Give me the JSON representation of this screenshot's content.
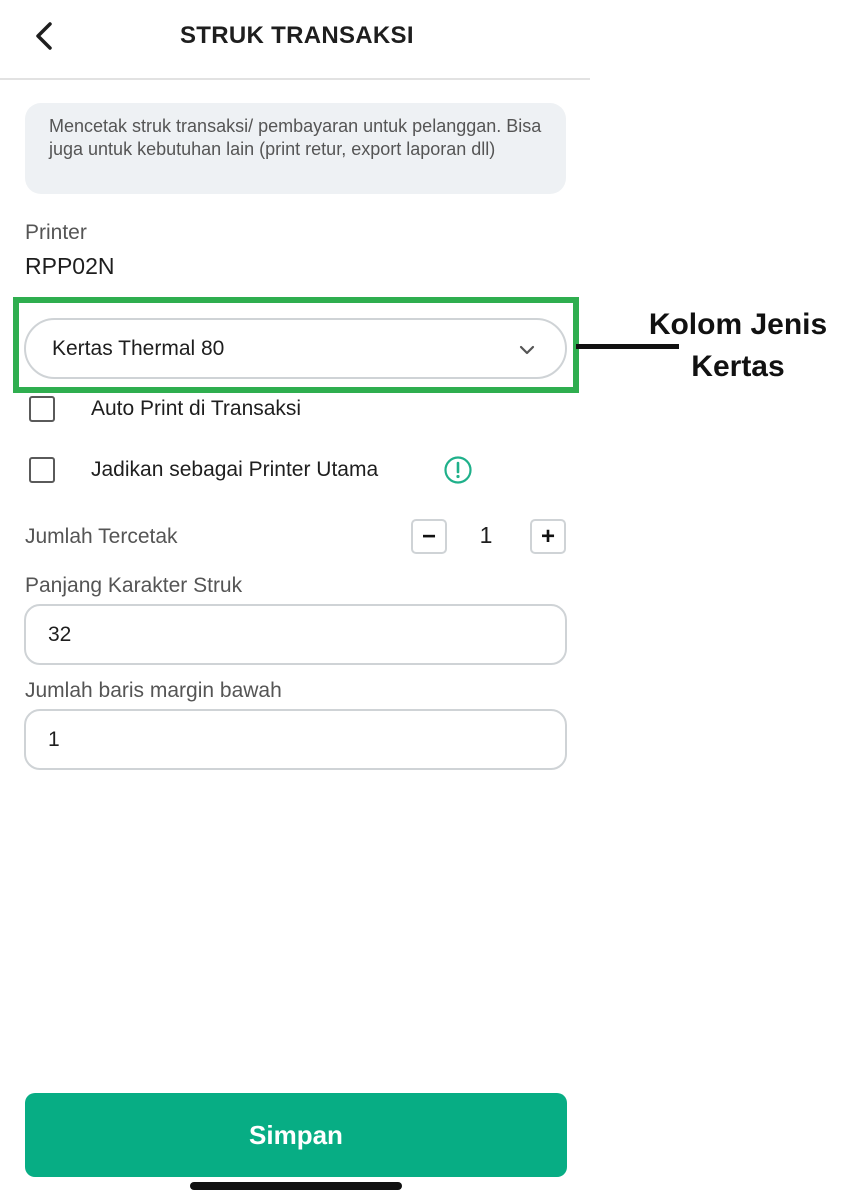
{
  "header": {
    "title": "STRUK TRANSAKSI",
    "back_icon": "chevron-left-icon"
  },
  "info": {
    "text": "Mencetak struk transaksi/ pembayaran untuk pelanggan. Bisa juga untuk kebutuhan lain (print retur, export laporan dll)"
  },
  "printer": {
    "label": "Printer",
    "value": "RPP02N"
  },
  "paper_select": {
    "selected": "Kertas Thermal 80",
    "icon": "chevron-down-icon"
  },
  "annotation": {
    "text": "Kolom Jenis Kertas",
    "highlight_color": "#2fae4f"
  },
  "options": {
    "auto_print": {
      "label": "Auto Print di Transaksi",
      "checked": false
    },
    "main_printer": {
      "label": "Jadikan sebagai Printer Utama",
      "checked": false,
      "icon": "info-circle-icon"
    }
  },
  "print_count": {
    "label": "Jumlah Tercetak",
    "value": "1",
    "decrement": "−",
    "increment": "+"
  },
  "char_length": {
    "label": "Panjang Karakter Struk",
    "value": "32"
  },
  "bottom_margin": {
    "label": "Jumlah baris margin bawah",
    "value": "1"
  },
  "save_button": {
    "label": "Simpan",
    "color": "#07ad84"
  }
}
